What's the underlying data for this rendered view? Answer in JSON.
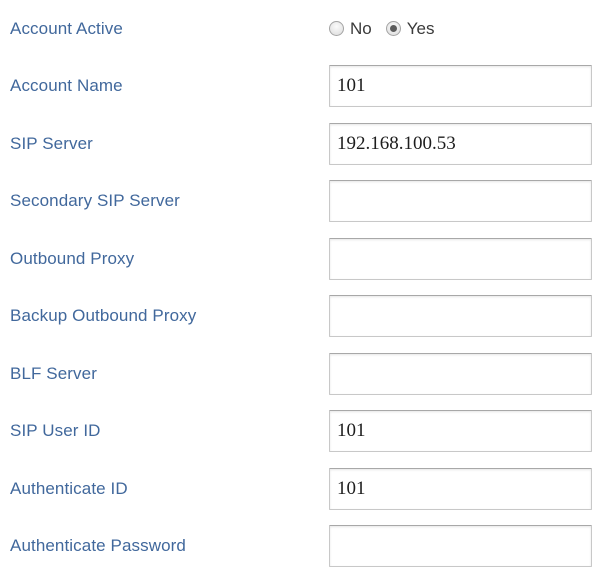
{
  "form": {
    "rows": [
      {
        "label": "Account Active",
        "control": "radio",
        "options": [
          {
            "label": "No",
            "value": "no",
            "checked": false
          },
          {
            "label": "Yes",
            "value": "yes",
            "checked": true
          }
        ]
      },
      {
        "label": "Account Name",
        "control": "text",
        "value": "101",
        "placeholder": ""
      },
      {
        "label": "SIP Server",
        "control": "text",
        "value": "192.168.100.53",
        "placeholder": ""
      },
      {
        "label": "Secondary SIP Server",
        "control": "text",
        "value": "",
        "placeholder": ""
      },
      {
        "label": "Outbound Proxy",
        "control": "text",
        "value": "",
        "placeholder": ""
      },
      {
        "label": "Backup Outbound Proxy",
        "control": "text",
        "value": "",
        "placeholder": ""
      },
      {
        "label": "BLF Server",
        "control": "text",
        "value": "",
        "placeholder": ""
      },
      {
        "label": "SIP User ID",
        "control": "text",
        "value": "101",
        "placeholder": ""
      },
      {
        "label": "Authenticate ID",
        "control": "text",
        "value": "101",
        "placeholder": ""
      },
      {
        "label": "Authenticate Password",
        "control": "password",
        "value": "",
        "placeholder": ""
      }
    ]
  },
  "colors": {
    "label": "#41689c",
    "input_border": "#c8c8c8",
    "input_border_top": "#a8a8a8",
    "radio_fill": "#5c5c5c",
    "background": "#ffffff",
    "value_text": "#1d1d1d"
  }
}
